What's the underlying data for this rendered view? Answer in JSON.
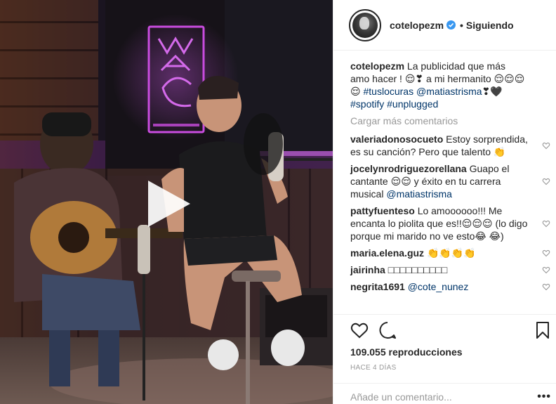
{
  "post": {
    "username": "cotelopezm",
    "follow_label": "Siguiendo",
    "separator": "•",
    "caption": {
      "text1": "La publicidad que más amo hacer ! 😌❣ a mi hermanito 😌😌😌😌",
      "hashtag1": "#tuslocuras",
      "mention1": "@matiastrisma",
      "text2": "❣🖤",
      "hashtag2": "#spotify",
      "hashtag3": "#unplugged"
    },
    "load_more_label": "Cargar más comentarios",
    "comments": [
      {
        "user": "valeriadonosocueto",
        "text": "Estoy sorprendida, es su canción? Pero que talento 👏"
      },
      {
        "user": "jocelynrodriguezorellana",
        "text": "Guapo el cantante 😌😌 y éxito en tu carrera musical",
        "mention": "@matiastrisma"
      },
      {
        "user": "pattyfuenteso",
        "text": "Lo amoooooo!!! Me encanta lo piolita que es!!😌😌😌 (lo digo porque mi marido no ve esto😂 😂)"
      },
      {
        "user": "maria.elena.guz",
        "text": "👏👏👏👏"
      },
      {
        "user": "jairinha",
        "text": "□□□□□□□□□□"
      },
      {
        "user": "negrita1691",
        "mention": "@cote_nunez"
      }
    ],
    "views": "109.055 reproducciones",
    "date": "HACE 4 DÍAS",
    "comment_placeholder": "Añade un comentario...",
    "more_label": "•••"
  },
  "icons": {
    "play": "play-icon",
    "verified": "verified-badge-icon",
    "like": "heart-outline-icon",
    "comment": "comment-bubble-icon",
    "save": "bookmark-icon",
    "comment_like": "small-heart-icon"
  },
  "colors": {
    "link": "#003569",
    "verified": "#3897f0",
    "muted": "#999999",
    "text": "#262626",
    "neon": "#c040d0"
  }
}
